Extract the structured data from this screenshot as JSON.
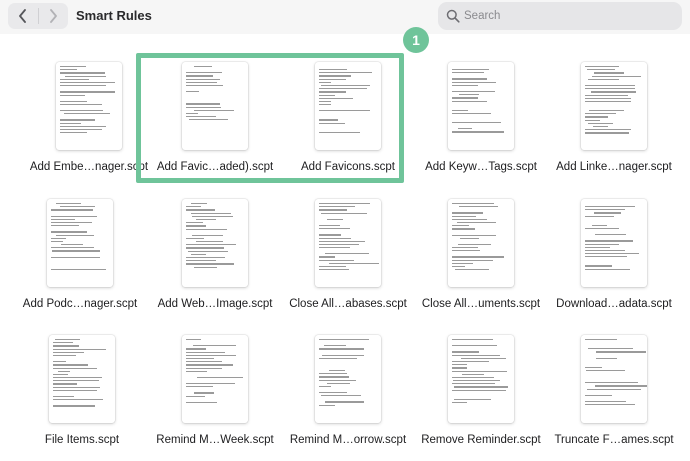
{
  "window": {
    "title": "Smart Rules"
  },
  "search": {
    "placeholder": "Search"
  },
  "annotation": {
    "badge": "1"
  },
  "files": [
    "Add Embe…nager.scpt",
    "Add Favic…aded).scpt",
    "Add Favicons.scpt",
    "Add Keyw…Tags.scpt",
    "Add Linke…nager.scpt",
    "Add Podc…nager.scpt",
    "Add Web…Image.scpt",
    "Close All…abases.scpt",
    "Close All…uments.scpt",
    "Download…adata.scpt",
    "File Items.scpt",
    "Remind M…Week.scpt",
    "Remind M…orrow.scpt",
    "Remove Reminder.scpt",
    "Truncate F…ames.scpt"
  ],
  "icons": {
    "back": "chevron-left-icon",
    "forward": "chevron-right-icon",
    "search": "magnifying-glass-icon",
    "file": "script-document-thumbnail"
  },
  "colors": {
    "highlight": "#6fc49a",
    "toolbar": "#f6f6f6",
    "search_bg": "#e6e6e8"
  }
}
